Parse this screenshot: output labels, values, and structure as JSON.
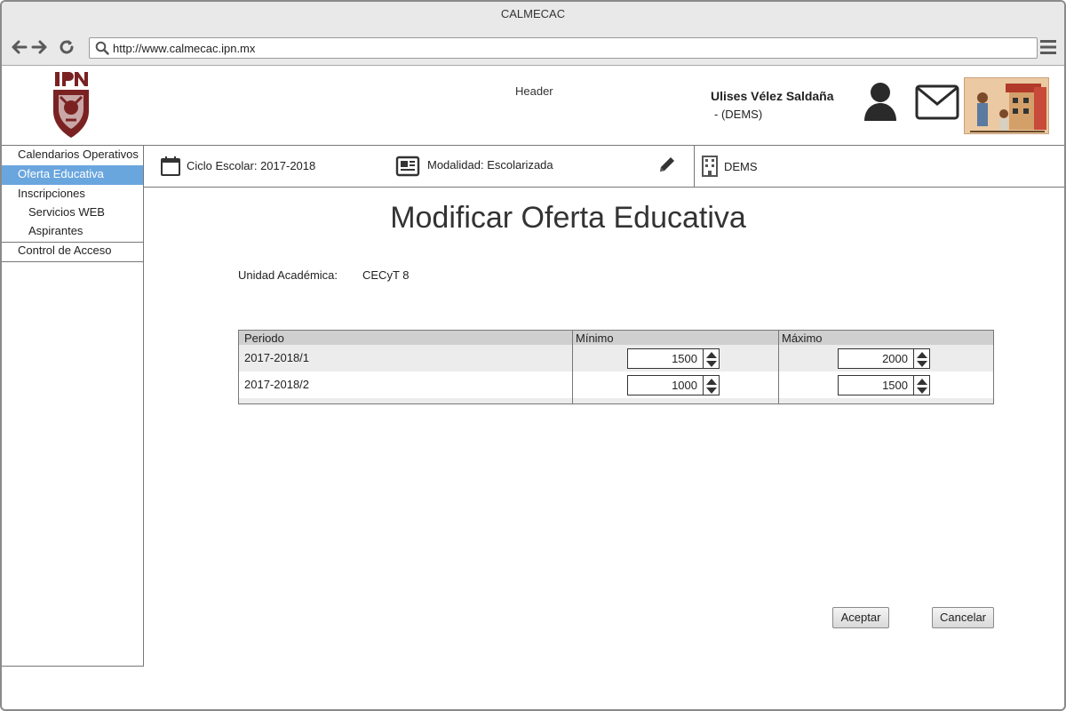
{
  "window": {
    "title": "CALMECAC"
  },
  "browser": {
    "url": "http://www.calmecac.ipn.mx",
    "back_icon": "arrow-left-icon",
    "forward_icon": "arrow-right-icon",
    "reload_icon": "reload-icon",
    "menu_icon": "hamburger-menu-icon"
  },
  "header": {
    "placeholder_text": "Header",
    "user": {
      "name": "Ulises Vélez Saldaña",
      "dept": "- (DEMS)"
    },
    "icons": [
      "ipn-logo",
      "user-icon",
      "mail-icon",
      "codex-image"
    ]
  },
  "sidebar": {
    "items": [
      {
        "label": "Calendarios Operativos",
        "level": 1,
        "active": false
      },
      {
        "label": "Oferta Educativa",
        "level": 1,
        "active": true
      },
      {
        "label": "Inscripciones",
        "level": 1,
        "active": false
      },
      {
        "label": "Servicios WEB",
        "level": 2,
        "active": false
      },
      {
        "label": "Aspirantes",
        "level": 2,
        "active": false
      },
      {
        "label": "Control de Acceso",
        "level": 1,
        "active": false
      }
    ],
    "active_color": "#6aa6de"
  },
  "infobar": {
    "ciclo": "Ciclo Escolar: 2017-2018",
    "modalidad": "Modalidad: Escolarizada",
    "dependencia": "DEMS"
  },
  "main": {
    "title": "Modificar Oferta Educativa",
    "unidad_label": "Unidad Académica:",
    "unidad_value": "CECyT 8",
    "table": {
      "columns": [
        "Periodo",
        "Mínimo",
        "Máximo"
      ],
      "rows": [
        {
          "periodo": "2017-2018/1",
          "minimo": "1500",
          "maximo": "2000"
        },
        {
          "periodo": "2017-2018/2",
          "minimo": "1000",
          "maximo": "1500"
        }
      ]
    },
    "buttons": {
      "accept": "Aceptar",
      "cancel": "Cancelar"
    }
  }
}
